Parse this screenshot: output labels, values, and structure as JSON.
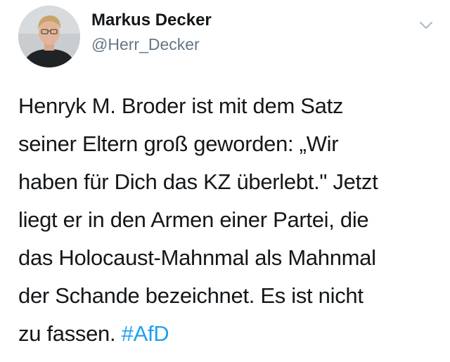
{
  "tweet": {
    "author": {
      "display_name": "Markus Decker",
      "handle": "@Herr_Decker"
    },
    "menu_icon": "chevron-down-icon",
    "text_lines": [
      "Henryk M. Broder ist mit dem Satz",
      "seiner Eltern groß geworden: „Wir",
      "haben für Dich das KZ überlebt.\" Jetzt",
      "liegt er in den Armen einer Partei, die",
      "das Holocaust-Mahnmal als Mahnmal",
      "der Schande bezeichnet. Es ist nicht"
    ],
    "last_line_text": "zu fassen. ",
    "hashtag": "#AfD"
  },
  "colors": {
    "text": "#14171a",
    "secondary": "#657786",
    "link": "#1da1f2",
    "caret": "#aab8c2"
  }
}
